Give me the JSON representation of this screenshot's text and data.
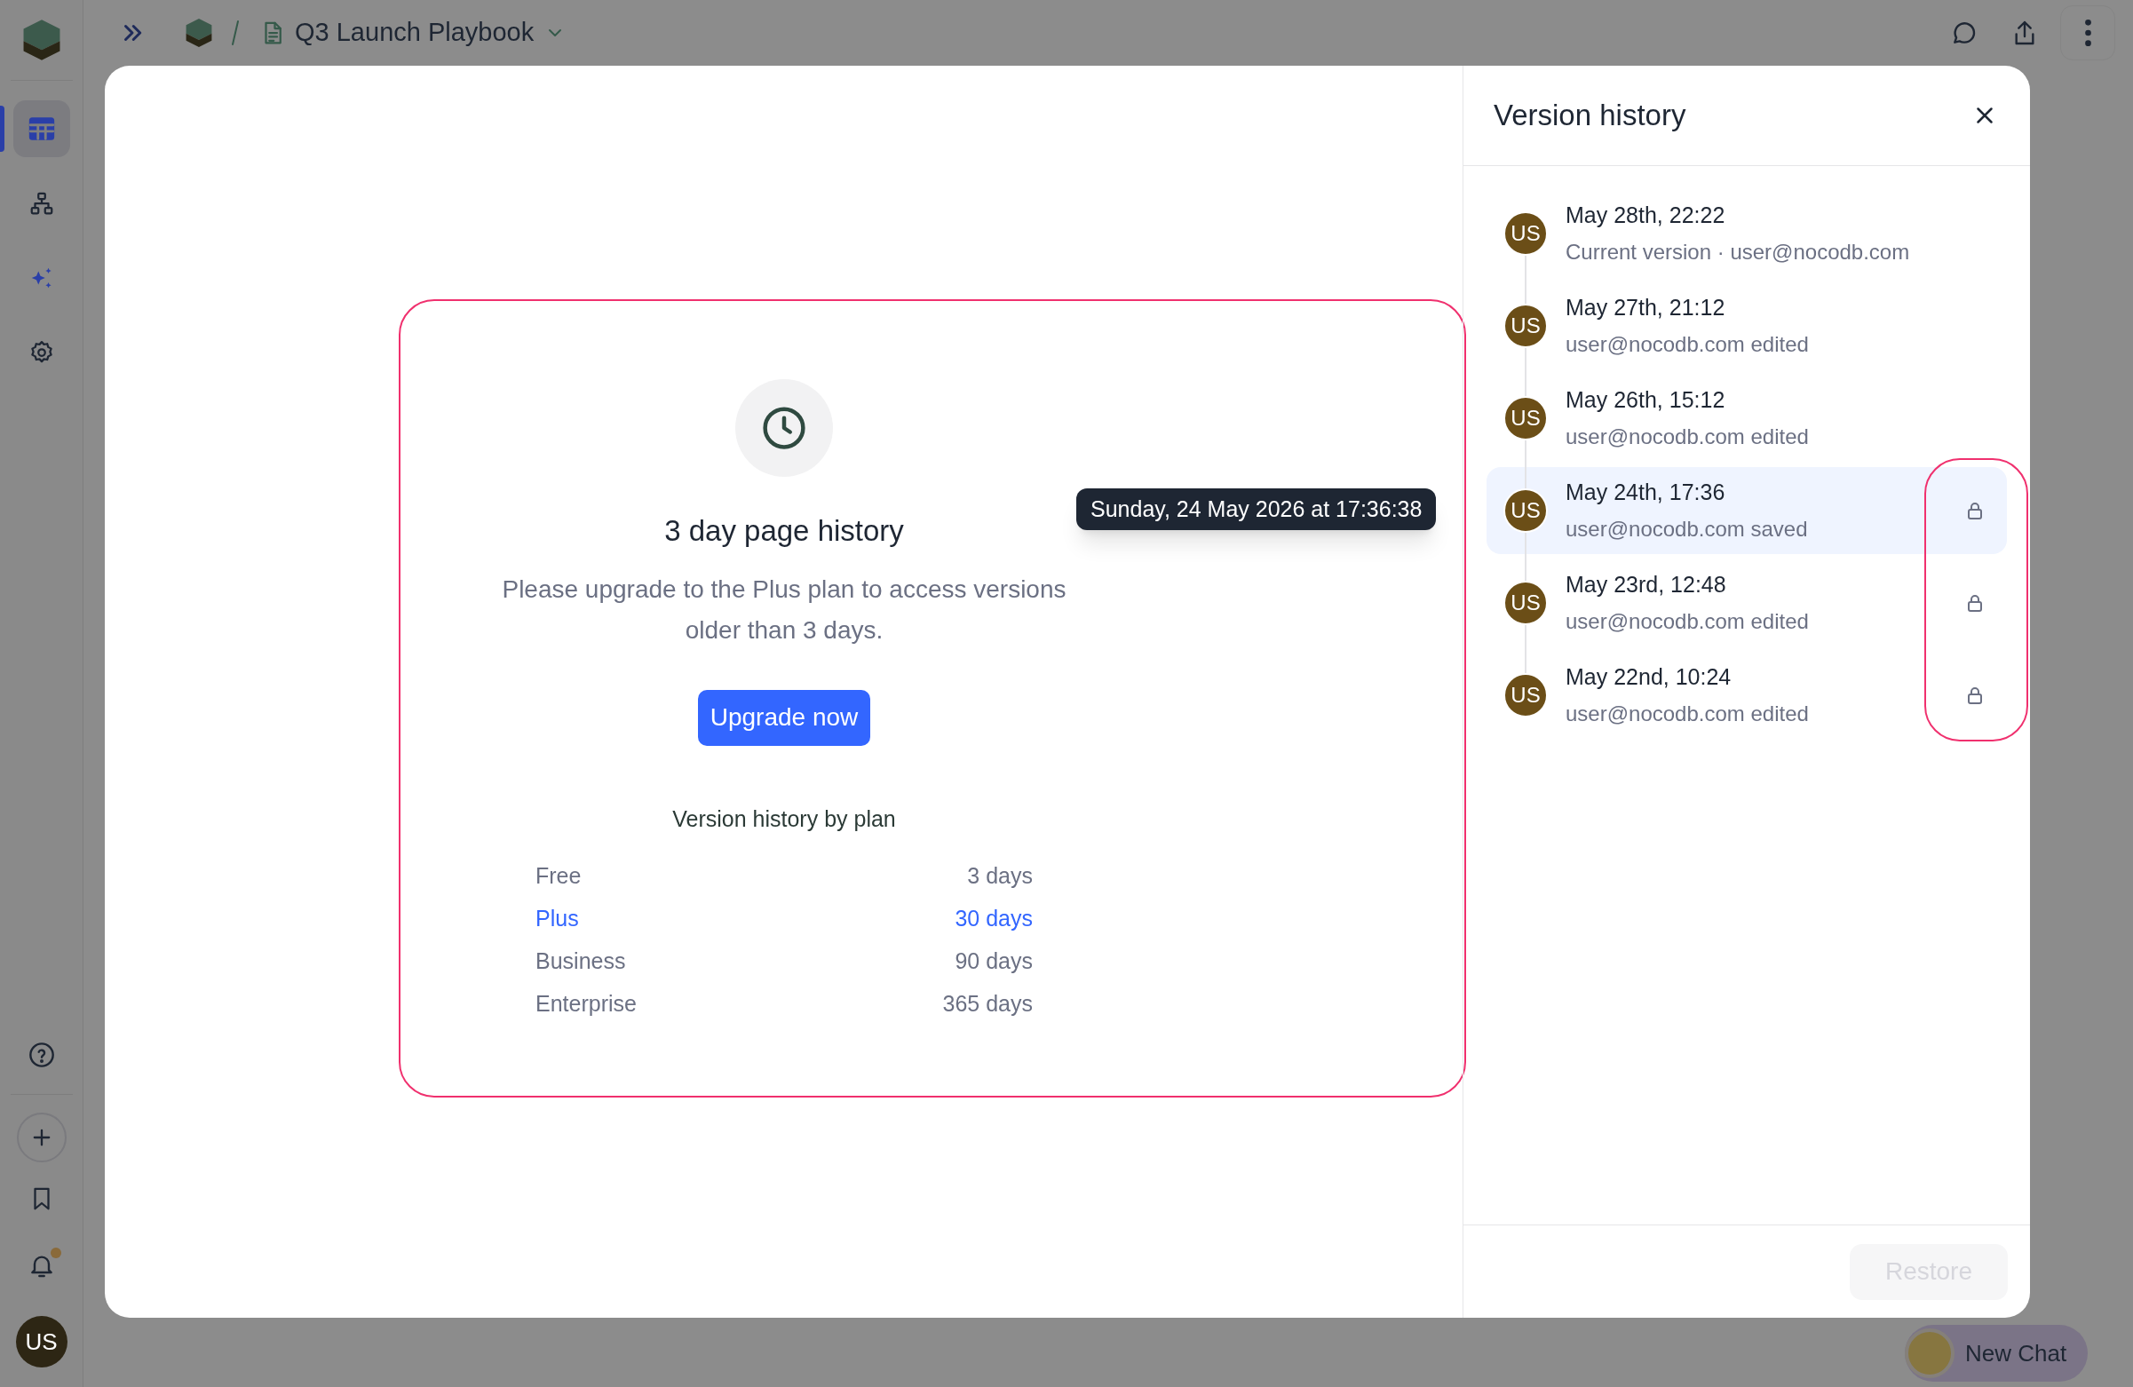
{
  "topbar": {
    "page_title": "Q3 Launch Playbook"
  },
  "sidebar": {
    "items": [
      {
        "kind": "grid",
        "selected": true
      },
      {
        "kind": "hierarchy",
        "selected": false
      },
      {
        "kind": "sparkle",
        "selected": false
      },
      {
        "kind": "settings",
        "selected": false
      }
    ],
    "bell_unread": true,
    "avatar": "US"
  },
  "upgrade_panel": {
    "title": "3 day page history",
    "message": "Please upgrade to the Plus plan to access versions older than 3 days.",
    "button": "Upgrade now",
    "plans_title": "Version history by plan",
    "plans": [
      {
        "name": "Free",
        "retention": "3 days",
        "highlighted": false
      },
      {
        "name": "Plus",
        "retention": "30 days",
        "highlighted": true
      },
      {
        "name": "Business",
        "retention": "90 days",
        "highlighted": false
      },
      {
        "name": "Enterprise",
        "retention": "365 days",
        "highlighted": false
      }
    ]
  },
  "tooltip": "Sunday, 24 May 2026 at 17:36:38",
  "version_history": {
    "title": "Version history",
    "versions": [
      {
        "avatar": "US",
        "time": "May 28th, 22:22",
        "detail": "Current version · user@nocodb.com",
        "selected": false,
        "locked": false
      },
      {
        "avatar": "US",
        "time": "May 27th, 21:12",
        "detail": "user@nocodb.com edited",
        "selected": false,
        "locked": false
      },
      {
        "avatar": "US",
        "time": "May 26th, 15:12",
        "detail": "user@nocodb.com edited",
        "selected": false,
        "locked": false
      },
      {
        "avatar": "US",
        "time": "May 24th, 17:36",
        "detail": "user@nocodb.com saved",
        "selected": true,
        "locked": true
      },
      {
        "avatar": "US",
        "time": "May 23rd, 12:48",
        "detail": "user@nocodb.com edited",
        "selected": false,
        "locked": true
      },
      {
        "avatar": "US",
        "time": "May 22nd, 10:24",
        "detail": "user@nocodb.com edited",
        "selected": false,
        "locked": true
      }
    ],
    "restore_button": {
      "label": "Restore",
      "disabled": true
    }
  },
  "chat_button": {
    "label": "New Chat"
  }
}
